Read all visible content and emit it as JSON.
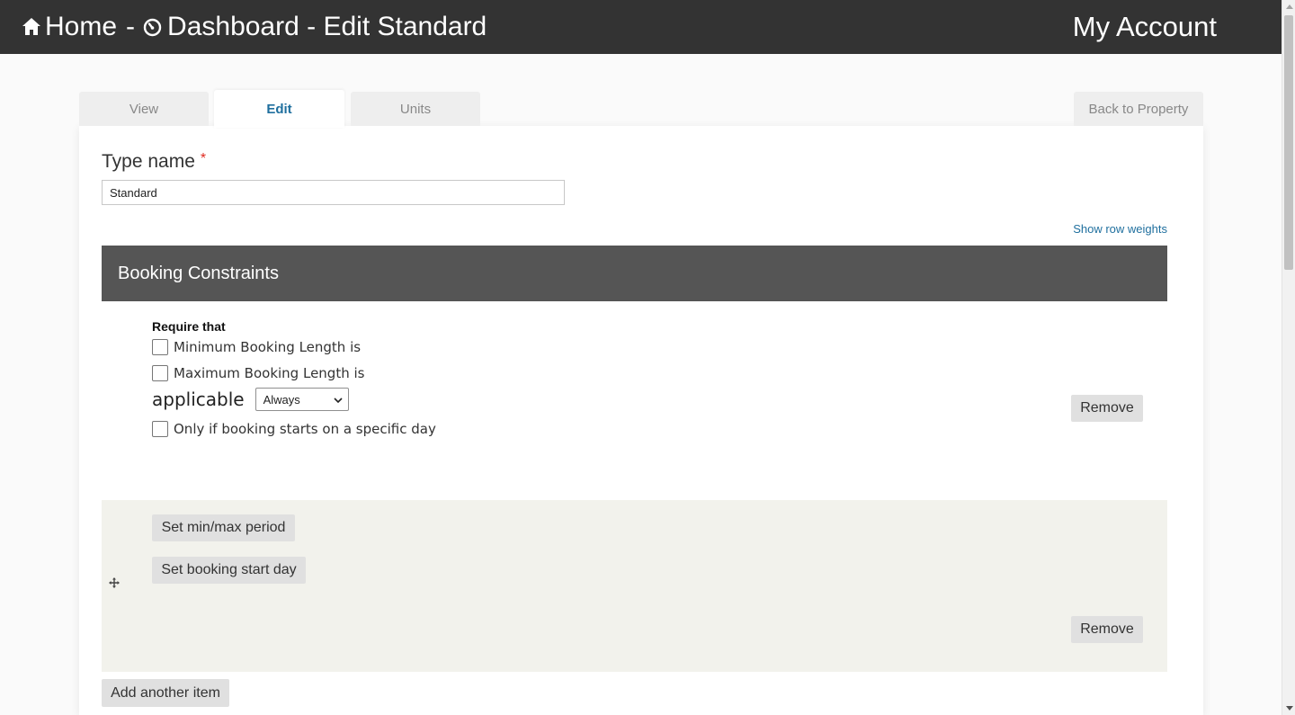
{
  "header": {
    "home_label": "Home",
    "separator": "-",
    "dashboard_label": "Dashboard - Edit Standard",
    "account_label": "My Account"
  },
  "tabs": [
    {
      "label": "View",
      "active": false
    },
    {
      "label": "Edit",
      "active": true
    },
    {
      "label": "Units",
      "active": false
    }
  ],
  "back_label": "Back to Property",
  "form": {
    "type_name_label": "Type name",
    "required_marker": "*",
    "type_name_value": "Standard",
    "show_row_weights": "Show row weights",
    "section_title": "Booking Constraints",
    "row1": {
      "require_title": "Require that",
      "min_label": "Minimum Booking Length is",
      "max_label": "Maximum Booking Length is",
      "applicable_label": "applicable",
      "applicable_value": "Always",
      "specific_day_label": "Only if booking starts on a specific day",
      "remove_label": "Remove"
    },
    "row2": {
      "min_max_label": "Set min/max period",
      "start_day_label": "Set booking start day",
      "remove_label": "Remove"
    },
    "add_item_label": "Add another item"
  },
  "colors": {
    "topbar": "#333333",
    "section_head": "#555555",
    "link": "#1f6f9e",
    "row_alt": "#f2f2ec",
    "required": "#e02b20"
  },
  "icons": {
    "home": "home-icon",
    "dashboard": "dashboard-gauge-icon",
    "drag": "drag-move-icon",
    "select": "chevron-down-icon"
  }
}
